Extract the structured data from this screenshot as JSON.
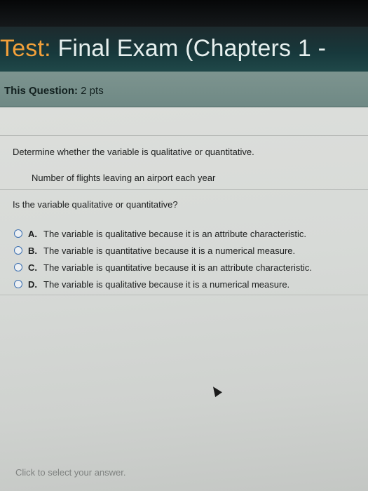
{
  "header": {
    "title_prefix": "Test:",
    "title_rest": "Final Exam (Chapters 1 -"
  },
  "points_bar": {
    "label": "This Question:",
    "value": "2 pts"
  },
  "question": {
    "instruction": "Determine whether the variable is qualitative or quantitative.",
    "variable": "Number of flights leaving an airport each year",
    "prompt": "Is the variable qualitative or quantitative?",
    "choices": [
      {
        "letter": "A.",
        "text": "The variable is qualitative because it is an attribute characteristic."
      },
      {
        "letter": "B.",
        "text": "The variable is quantitative because it is a numerical measure."
      },
      {
        "letter": "C.",
        "text": "The variable is quantitative because it is an attribute characteristic."
      },
      {
        "letter": "D.",
        "text": "The variable is qualitative because it is a numerical measure."
      }
    ]
  },
  "footer": {
    "hint": "Click to select your answer."
  }
}
